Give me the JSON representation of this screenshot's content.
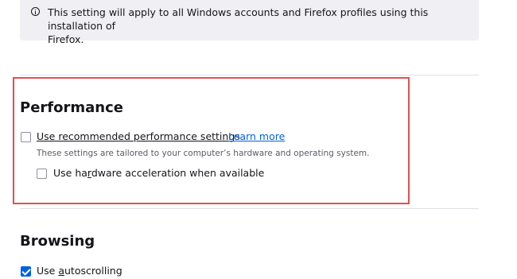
{
  "notice": {
    "icon": "info-icon",
    "line1": "This setting will apply to all Windows accounts and Firefox profiles using this installation of",
    "line2": "Firefox."
  },
  "performance": {
    "heading": "Performance",
    "recommended": {
      "checked": false,
      "label": "Use recommended performance settings",
      "learn_more": "Learn more",
      "description": "These settings are tailored to your computer’s hardware and operating system."
    },
    "hardware": {
      "checked": false,
      "label_pre": "Use ha",
      "label_accel": "r",
      "label_post": "dware acceleration when available"
    }
  },
  "browsing": {
    "heading": "Browsing",
    "autoscroll": {
      "checked": true,
      "label_pre": "Use ",
      "label_accel": "a",
      "label_post": "utoscrolling"
    }
  },
  "colors": {
    "accent": "#0061e0",
    "highlight": "#e05050",
    "notice_bg": "#f0f0f4"
  }
}
